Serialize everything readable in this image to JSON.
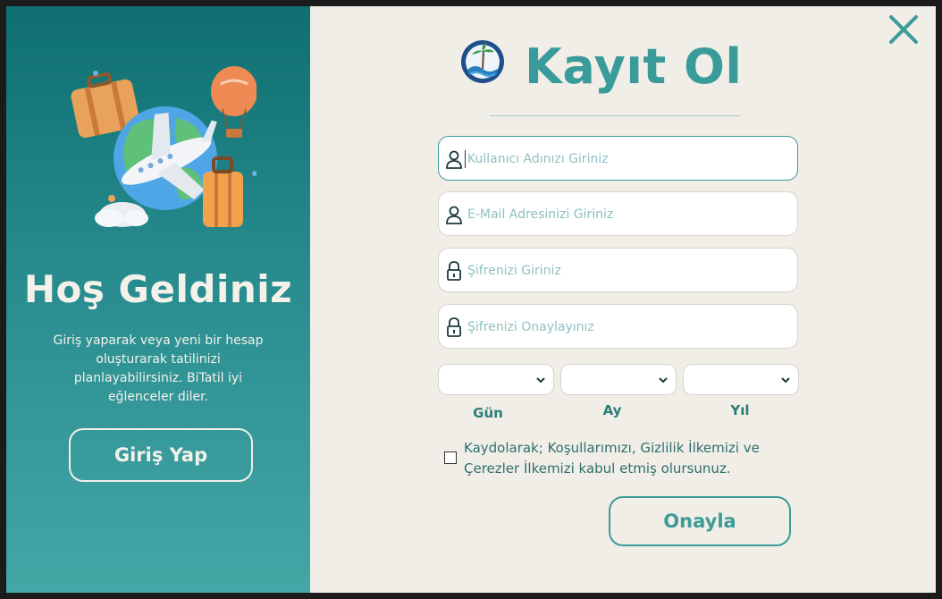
{
  "welcome": {
    "title": "Hoş Geldiniz",
    "text": "Giriş yaparak veya yeni bir hesap oluşturarak tatilinizi planlayabilirsiniz. BiTatil iyi eğlenceler diler.",
    "login_button": "Giriş Yap"
  },
  "register": {
    "title": "Kayıt Ol",
    "fields": {
      "username_placeholder": "Kullanıcı Adınızı Giriniz",
      "email_placeholder": "E-Mail Adresinizi Giriniz",
      "password_placeholder": "Şifrenizi Giriniz",
      "password_confirm_placeholder": "Şifrenizi Onaylayınız"
    },
    "birthdate": {
      "day_label": "Gün",
      "month_label": "Ay",
      "year_label": "Yıl"
    },
    "terms_text": "Kaydolarak; Koşullarımızı, Gizlilik İlkemizi ve Çerezler İlkemizi kabul etmiş olursunuz.",
    "confirm_button": "Onayla"
  },
  "icons": {
    "close": "close-icon",
    "user": "user-icon",
    "lock": "lock-icon",
    "chevron": "chevron-down-icon",
    "brand": "brand-logo"
  },
  "colors": {
    "accent": "#3d9b98",
    "panel_top": "#0f6f71",
    "panel_bottom": "#45a6a6",
    "background": "#f1eee7"
  }
}
